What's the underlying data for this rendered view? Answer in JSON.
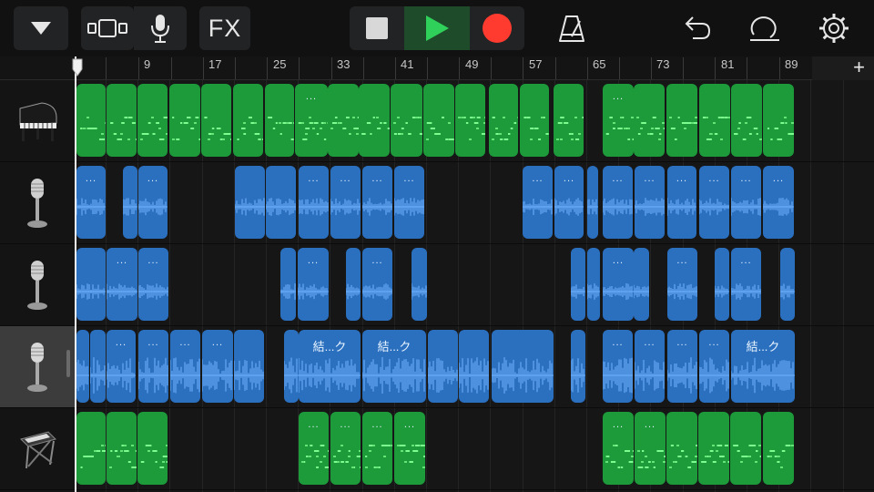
{
  "toolbar": {
    "fx_label": "FX",
    "buttons": [
      "browser-menu",
      "view-toggle",
      "microphone",
      "fx",
      "stop",
      "play",
      "record",
      "metronome",
      "undo",
      "loop-browser",
      "settings"
    ]
  },
  "ruler": {
    "bars": [
      "9",
      "17",
      "25",
      "33",
      "41",
      "49",
      "57",
      "65",
      "73",
      "81",
      "89"
    ],
    "add_track_label": "+"
  },
  "colors": {
    "midi_region": "#1d9a3a",
    "audio_region": "#2b6fbf",
    "play": "#2fd15a",
    "record": "#ff3b30"
  },
  "tracks": [
    {
      "instrument": "grand-piano",
      "type": "midi",
      "selected": false
    },
    {
      "instrument": "microphone",
      "type": "audio",
      "selected": false
    },
    {
      "instrument": "microphone",
      "type": "audio",
      "selected": false
    },
    {
      "instrument": "microphone",
      "type": "audio",
      "selected": true
    },
    {
      "instrument": "keyboard-synth",
      "type": "midi",
      "selected": false
    }
  ],
  "region_labels": {
    "dots": "...",
    "ketsu_ku": "結...ク"
  }
}
